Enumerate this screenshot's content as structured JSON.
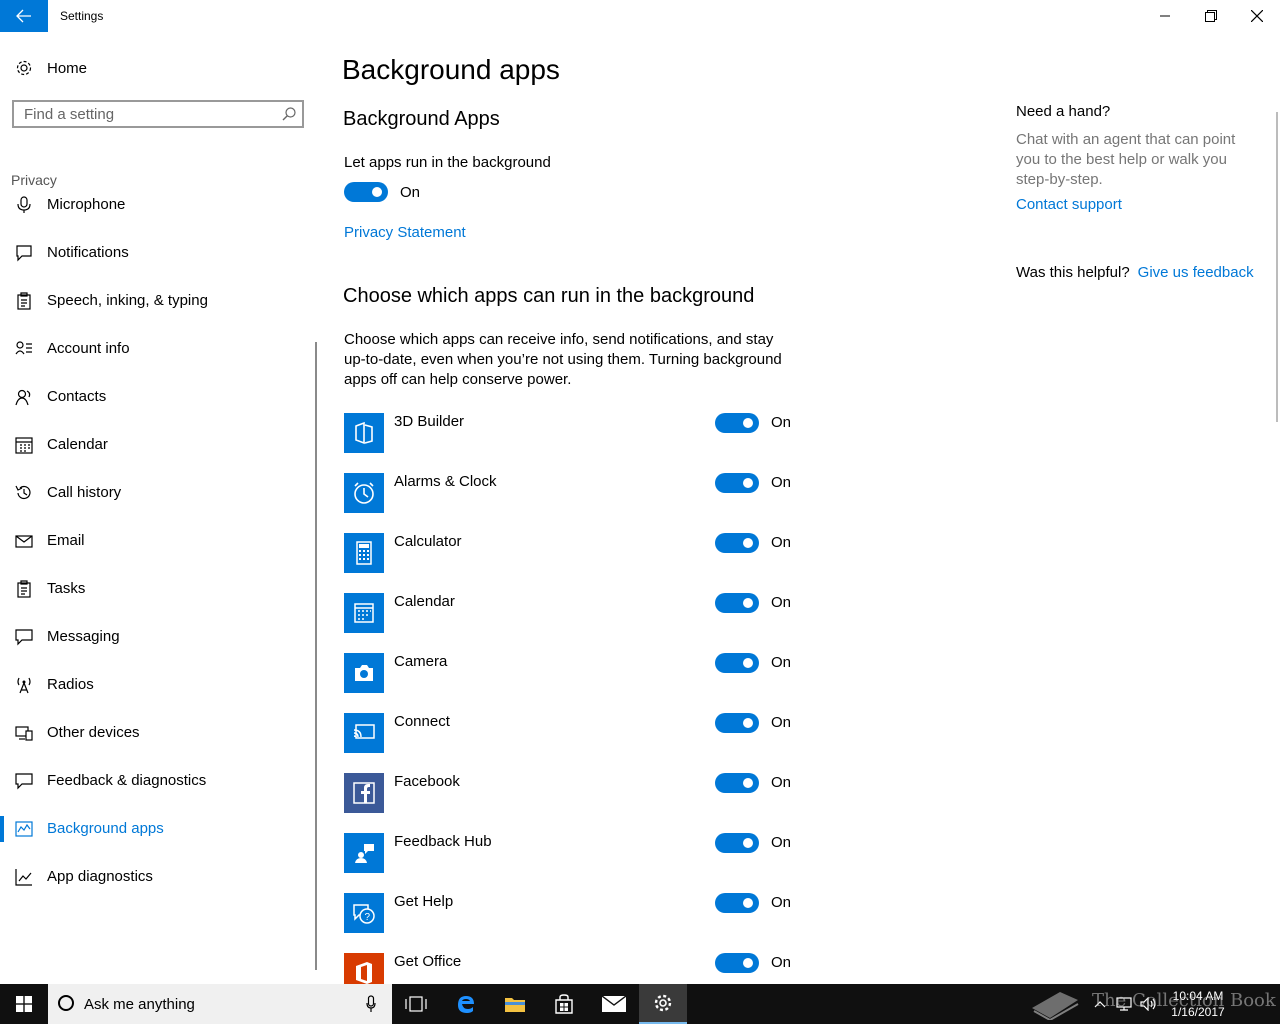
{
  "window": {
    "title": "Settings"
  },
  "sidebar": {
    "home_label": "Home",
    "search_placeholder": "Find a setting",
    "section_label": "Privacy",
    "items": [
      {
        "label": "Microphone",
        "icon": "microphone-icon"
      },
      {
        "label": "Notifications",
        "icon": "notification-icon"
      },
      {
        "label": "Speech, inking, & typing",
        "icon": "clipboard-icon"
      },
      {
        "label": "Account info",
        "icon": "account-info-icon"
      },
      {
        "label": "Contacts",
        "icon": "contacts-icon"
      },
      {
        "label": "Calendar",
        "icon": "calendar-icon"
      },
      {
        "label": "Call history",
        "icon": "history-icon"
      },
      {
        "label": "Email",
        "icon": "mail-icon"
      },
      {
        "label": "Tasks",
        "icon": "tasks-icon"
      },
      {
        "label": "Messaging",
        "icon": "message-icon"
      },
      {
        "label": "Radios",
        "icon": "radio-tower-icon"
      },
      {
        "label": "Other devices",
        "icon": "devices-icon"
      },
      {
        "label": "Feedback & diagnostics",
        "icon": "feedback-icon"
      },
      {
        "label": "Background apps",
        "icon": "background-apps-icon",
        "active": true
      },
      {
        "label": "App diagnostics",
        "icon": "app-diagnostics-icon"
      }
    ]
  },
  "main": {
    "title": "Background apps",
    "subtitle": "Background Apps",
    "let_apps_label": "Let apps run in the background",
    "master_toggle_state": "On",
    "privacy_link": "Privacy Statement",
    "choose_title": "Choose which apps can run in the background",
    "description": "Choose which apps can receive info, send notifications, and stay up-to-date, even when you’re not using them. Turning background apps off can help conserve power.",
    "apps": [
      {
        "name": "3D Builder",
        "state": "On",
        "icon": "3d-builder-icon",
        "color": "#0078d7"
      },
      {
        "name": "Alarms & Clock",
        "state": "On",
        "icon": "alarm-clock-icon",
        "color": "#0078d7"
      },
      {
        "name": "Calculator",
        "state": "On",
        "icon": "calculator-icon",
        "color": "#0078d7"
      },
      {
        "name": "Calendar",
        "state": "On",
        "icon": "calendar-app-icon",
        "color": "#0078d7"
      },
      {
        "name": "Camera",
        "state": "On",
        "icon": "camera-icon",
        "color": "#0078d7"
      },
      {
        "name": "Connect",
        "state": "On",
        "icon": "connect-icon",
        "color": "#0078d7"
      },
      {
        "name": "Facebook",
        "state": "On",
        "icon": "facebook-icon",
        "color": "#3b5998"
      },
      {
        "name": "Feedback Hub",
        "state": "On",
        "icon": "feedback-hub-icon",
        "color": "#0078d7"
      },
      {
        "name": "Get Help",
        "state": "On",
        "icon": "get-help-icon",
        "color": "#0078d7"
      },
      {
        "name": "Get Office",
        "state": "On",
        "icon": "office-icon",
        "color": "#d83b01"
      }
    ]
  },
  "help": {
    "title": "Need a hand?",
    "text": "Chat with an agent that can point you to the best help or walk you step-by-step.",
    "contact_link": "Contact support",
    "helpful_label": "Was this helpful?",
    "feedback_link": "Give us feedback"
  },
  "taskbar": {
    "search_text": "Ask me anything",
    "time": "10:04 AM",
    "date": "1/16/2017",
    "watermark": "The Collection Book"
  },
  "colors": {
    "accent": "#0078d7",
    "taskbar": "#101010"
  }
}
